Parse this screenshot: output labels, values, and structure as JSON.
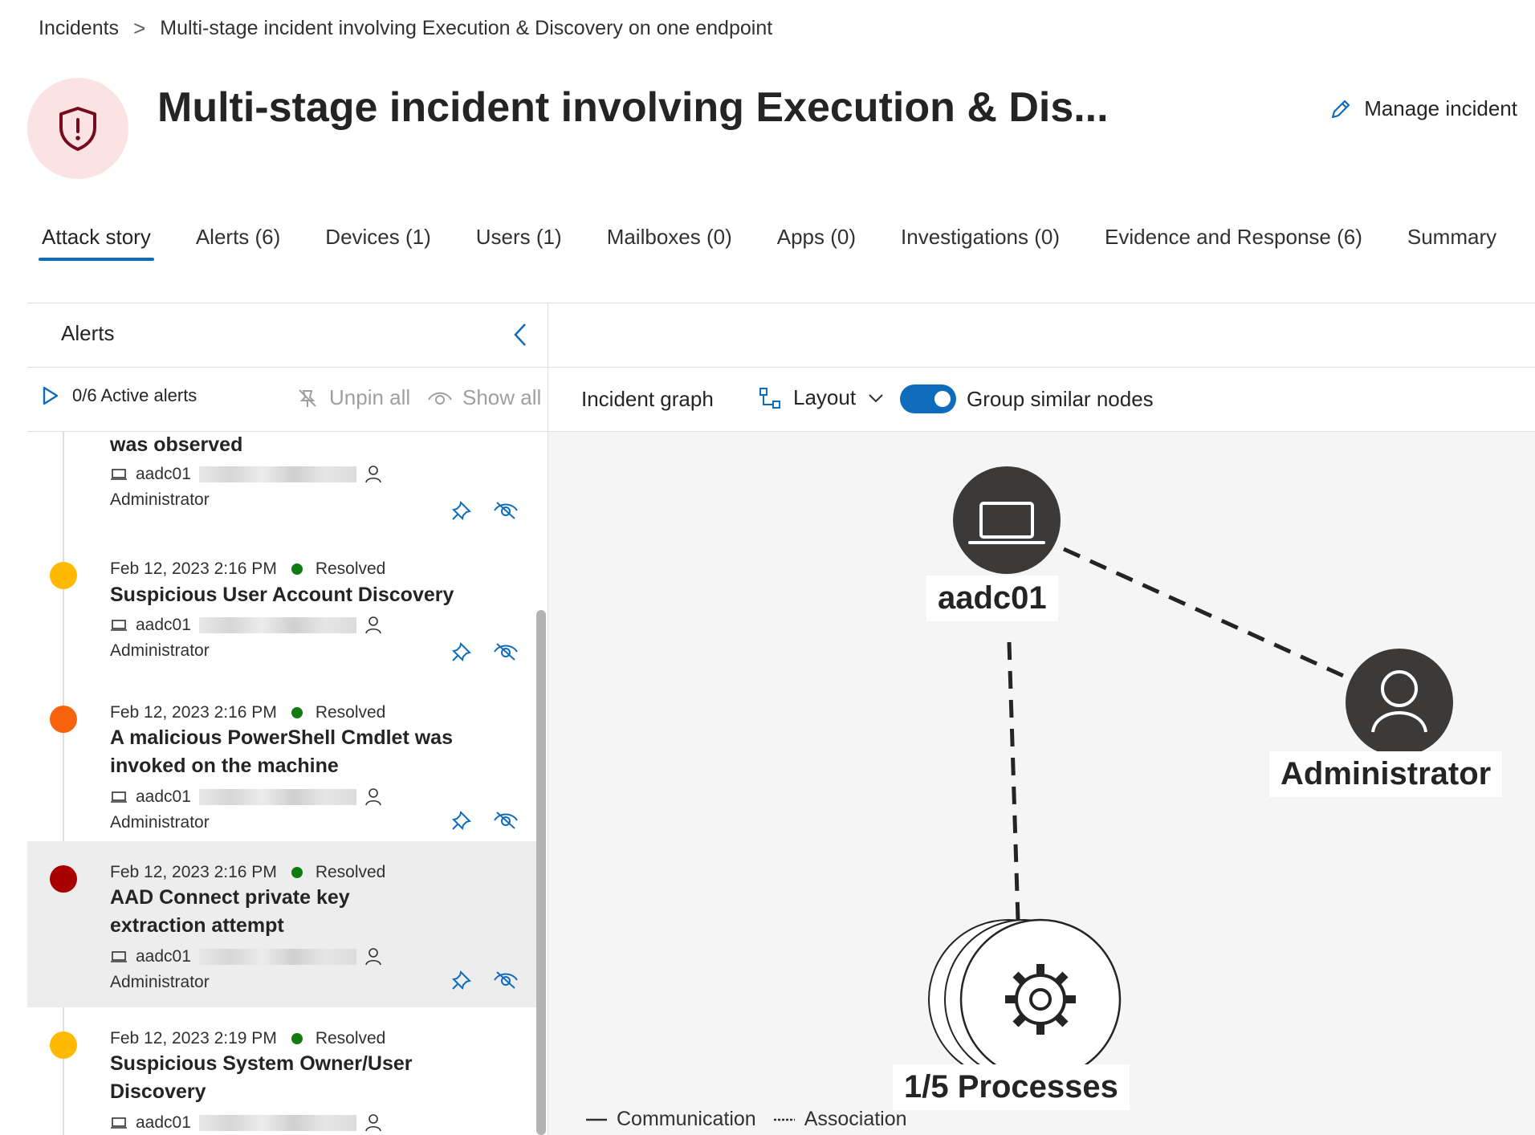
{
  "breadcrumb": {
    "root": "Incidents",
    "separator": ">",
    "current": "Multi-stage incident involving Execution & Discovery on one endpoint"
  },
  "header": {
    "title": "Multi-stage incident involving Execution & Dis...",
    "manage_label": "Manage incident",
    "icon": "shield-alert-icon"
  },
  "tabs": [
    {
      "label": "Attack story",
      "active": true
    },
    {
      "label": "Alerts (6)"
    },
    {
      "label": "Devices (1)"
    },
    {
      "label": "Users (1)"
    },
    {
      "label": "Mailboxes (0)"
    },
    {
      "label": "Apps (0)"
    },
    {
      "label": "Investigations (0)"
    },
    {
      "label": "Evidence and Response (6)"
    },
    {
      "label": "Summary"
    }
  ],
  "alerts_panel": {
    "title": "Alerts",
    "active_alerts": "0/6 Active alerts",
    "unpin_all": "Unpin all",
    "show_all": "Show all",
    "items": [
      {
        "title": "was observed",
        "device": "aadc01",
        "user": "Administrator"
      },
      {
        "severity_color": "#ffb900",
        "date": "Feb 12, 2023 2:16 PM",
        "status": "Resolved",
        "title": "Suspicious User Account Discovery",
        "device": "aadc01",
        "user": "Administrator"
      },
      {
        "severity_color": "#f7630c",
        "date": "Feb 12, 2023 2:16 PM",
        "status": "Resolved",
        "title_line1": "A malicious PowerShell Cmdlet was",
        "title_line2": "invoked on the machine",
        "device": "aadc01",
        "user": "Administrator"
      },
      {
        "severity_color": "#a80000",
        "date": "Feb 12, 2023 2:16 PM",
        "status": "Resolved",
        "title_line1": "AAD Connect private key",
        "title_line2": "extraction attempt",
        "device": "aadc01",
        "user": "Administrator",
        "selected": true
      },
      {
        "severity_color": "#ffb900",
        "date": "Feb 12, 2023 2:19 PM",
        "status": "Resolved",
        "title_line1": "Suspicious System Owner/User",
        "title_line2": "Discovery",
        "device": "aadc01"
      }
    ]
  },
  "graph": {
    "title": "Incident graph",
    "layout_label": "Layout",
    "group_label": "Group similar nodes",
    "group_enabled": true,
    "nodes": {
      "device": "aadc01",
      "user": "Administrator",
      "processes": "1/5 Processes"
    },
    "legend": {
      "communication": "Communication",
      "association": "Association"
    }
  },
  "colors": {
    "accent": "#0f6cbd",
    "resolved": "#107c10",
    "node_dark": "#3b3a39"
  }
}
